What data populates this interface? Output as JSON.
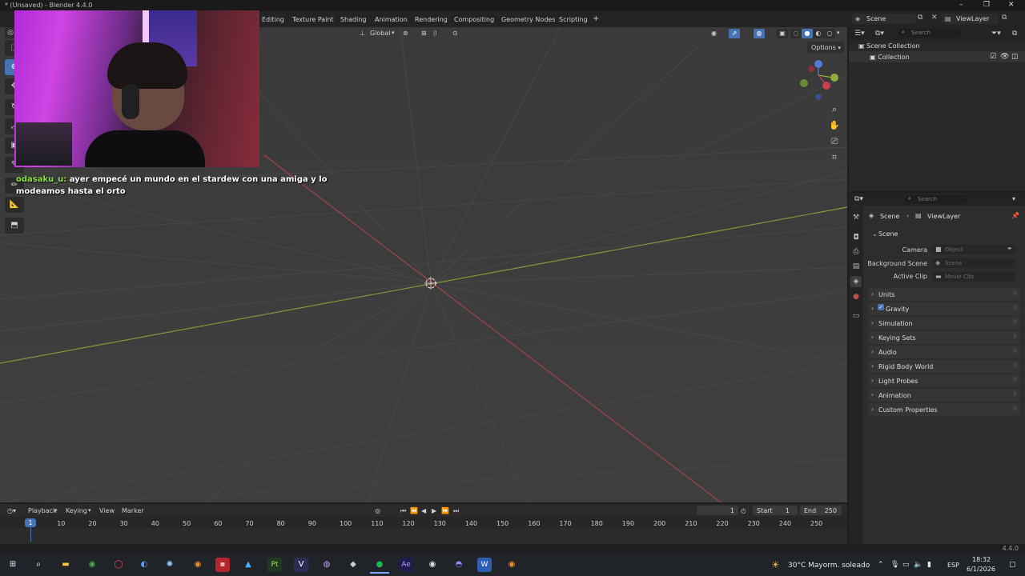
{
  "window": {
    "title": "* (Unsaved) - Blender 4.4.0",
    "controls": [
      "–",
      "❐",
      "✕"
    ]
  },
  "workspaces": [
    "Editing",
    "Texture Paint",
    "Shading",
    "Animation",
    "Rendering",
    "Compositing",
    "Geometry Nodes",
    "Scripting"
  ],
  "topbar": {
    "add_workspace": "+",
    "scene_name": "Scene",
    "viewlayer_name": "ViewLayer"
  },
  "viewport_header": {
    "orientation": "Global",
    "options": "Options"
  },
  "chat": {
    "username": "odasaku_u:",
    "message": "ayer empecé un mundo en el stardew con una amiga y lo modeamos hasta el orto"
  },
  "timeline": {
    "menus": [
      "Playback",
      "Keying",
      "View",
      "Marker"
    ],
    "current_frame": "1",
    "start_label": "Start",
    "start": "1",
    "end_label": "End",
    "end": "250",
    "ticks": [
      "10",
      "20",
      "30",
      "40",
      "50",
      "60",
      "70",
      "80",
      "90",
      "100",
      "110",
      "120",
      "130",
      "140",
      "150",
      "160",
      "170",
      "180",
      "190",
      "200",
      "210",
      "220",
      "230",
      "240",
      "250"
    ],
    "playhead": "1"
  },
  "version": "4.4.0",
  "outliner": {
    "search_placeholder": "Search",
    "root": "Scene Collection",
    "child": "Collection"
  },
  "properties": {
    "search_placeholder": "Search",
    "breadcrumb_scene": "Scene",
    "breadcrumb_viewlayer": "ViewLayer",
    "section": "Scene",
    "camera_label": "Camera",
    "camera_placeholder": "Object",
    "bg_scene_label": "Background Scene",
    "bg_scene_placeholder": "Scene",
    "active_clip_label": "Active Clip",
    "active_clip_placeholder": "Movie Clip",
    "panels": [
      "Units",
      "Gravity",
      "Simulation",
      "Keying Sets",
      "Audio",
      "Rigid Body World",
      "Light Probes",
      "Animation",
      "Custom Properties"
    ]
  },
  "taskbar": {
    "weather": "30°C  Mayorm. soleado",
    "language": "ESP",
    "time": "18:32",
    "date": "6/1/2026"
  },
  "colors": {
    "accent": "#4772b3",
    "x_axis": "#b3404a",
    "y_axis": "#8db03d",
    "chat_user": "#8ee23d"
  }
}
